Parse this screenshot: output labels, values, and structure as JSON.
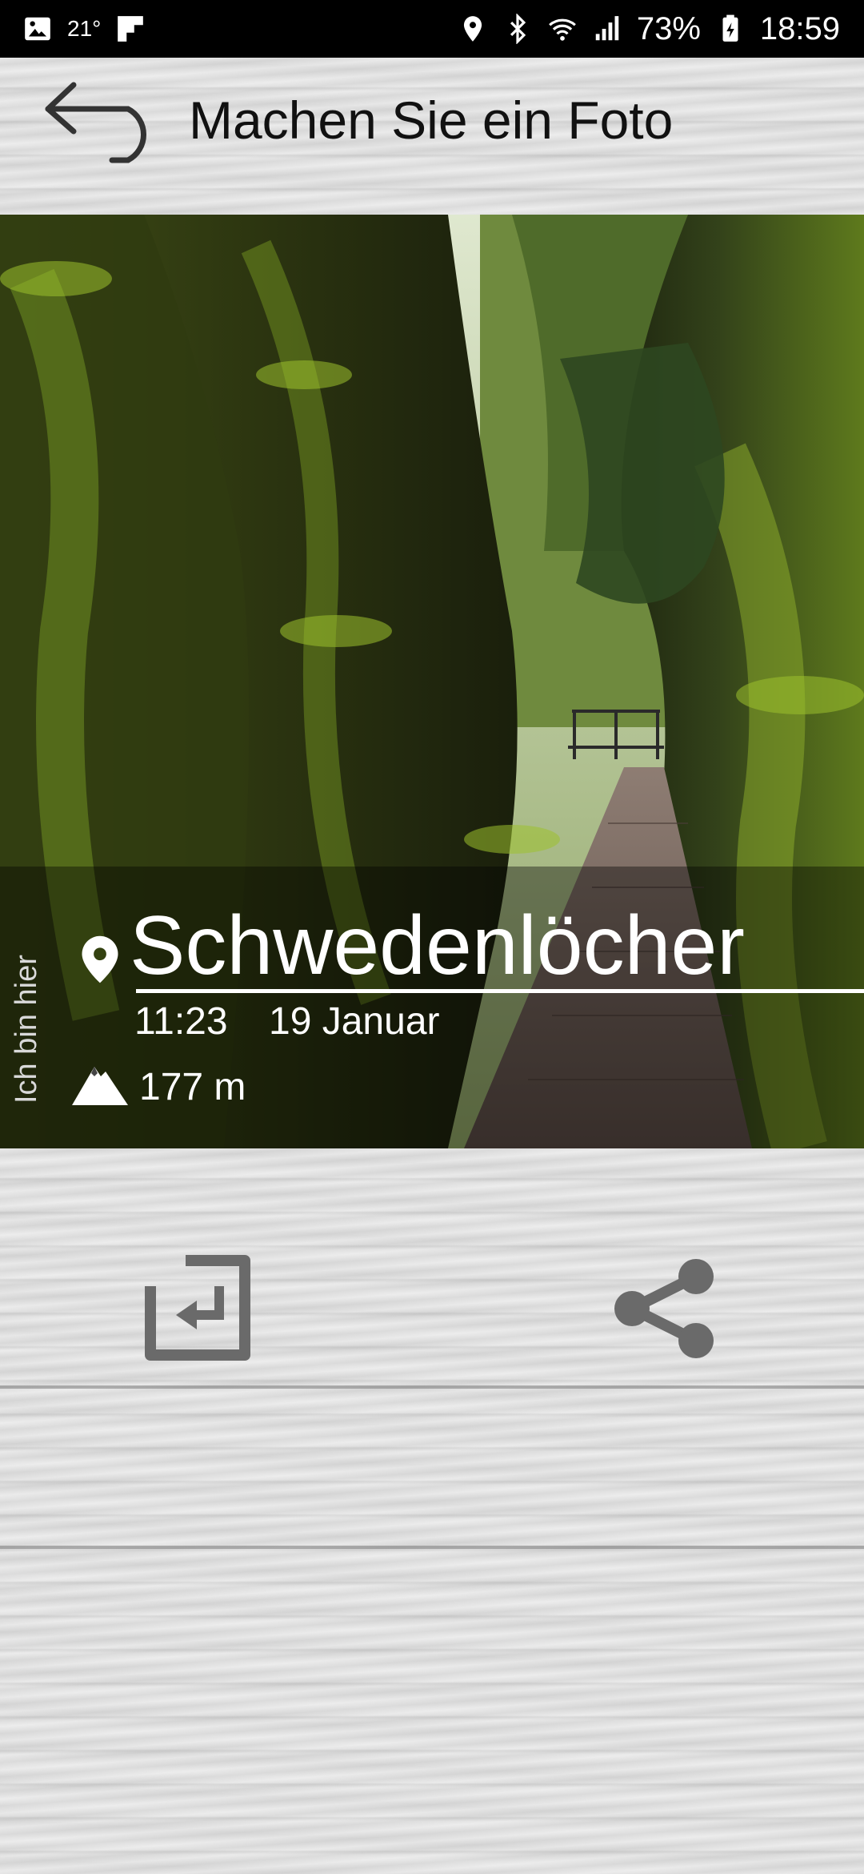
{
  "status_bar": {
    "temperature": "21°",
    "battery": "73%",
    "time": "18:59",
    "icons": [
      "gallery-icon",
      "temperature",
      "flipboard-icon",
      "location-icon",
      "bluetooth-icon",
      "wifi-icon",
      "signal-icon",
      "battery-icon"
    ]
  },
  "header": {
    "title": "Machen Sie ein Foto",
    "back_icon": "back-arrow-icon"
  },
  "photo": {
    "vertical_label": "Ich bin hier",
    "place_name": "Schwedenlöcher",
    "time": "11:23",
    "date": "19 Januar",
    "altitude": "177 m"
  },
  "actions": {
    "import_icon": "import-icon",
    "share_icon": "share-icon"
  }
}
